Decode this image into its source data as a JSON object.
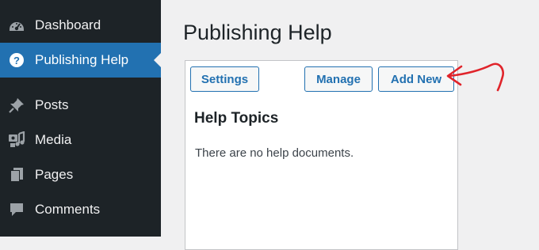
{
  "sidebar": {
    "items": [
      {
        "label": "Dashboard",
        "icon": "dashboard-icon",
        "active": false
      },
      {
        "label": "Publishing Help",
        "icon": "help-icon",
        "active": true
      },
      {
        "label": "Posts",
        "icon": "pin-icon",
        "active": false
      },
      {
        "label": "Media",
        "icon": "media-icon",
        "active": false
      },
      {
        "label": "Pages",
        "icon": "pages-icon",
        "active": false
      },
      {
        "label": "Comments",
        "icon": "comments-icon",
        "active": false
      }
    ]
  },
  "main": {
    "title": "Publishing Help",
    "buttons": {
      "settings": "Settings",
      "manage": "Manage",
      "add_new": "Add New"
    },
    "section_heading": "Help Topics",
    "empty_message": "There are no help documents."
  },
  "colors": {
    "sidebar_bg": "#1d2327",
    "active_bg": "#2271b1",
    "accent": "#2271b1",
    "annotation": "#e0242b"
  }
}
